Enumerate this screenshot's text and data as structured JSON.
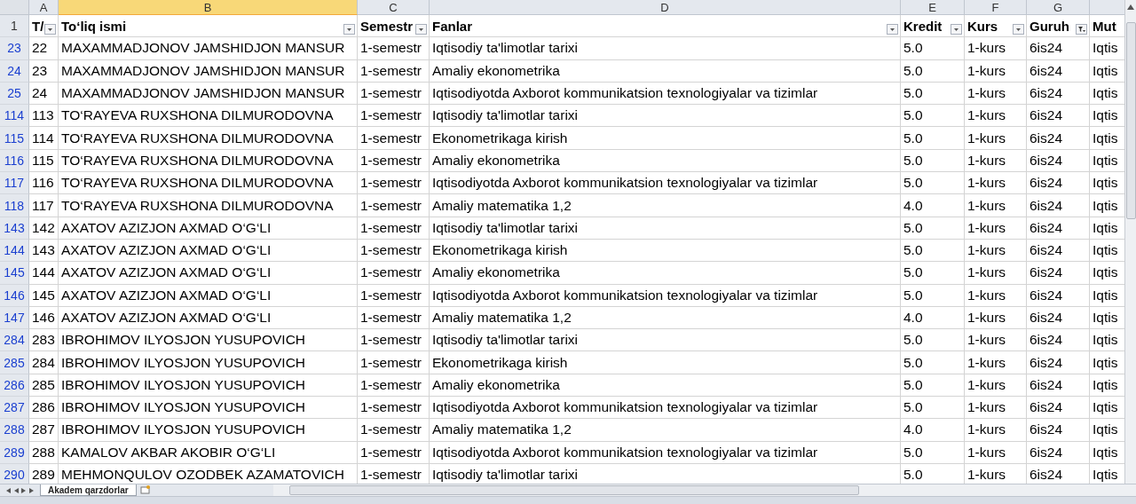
{
  "columns": [
    {
      "letter": "A",
      "selected": false
    },
    {
      "letter": "B",
      "selected": true
    },
    {
      "letter": "C",
      "selected": false
    },
    {
      "letter": "D",
      "selected": false
    },
    {
      "letter": "E",
      "selected": false
    },
    {
      "letter": "F",
      "selected": false
    },
    {
      "letter": "G",
      "selected": false
    }
  ],
  "header_row": {
    "number": "1",
    "cells": [
      {
        "text": "T/",
        "filtered": false
      },
      {
        "text": "To‘liq ismi",
        "filtered": false
      },
      {
        "text": "Semestr",
        "filtered": false
      },
      {
        "text": "Fanlar",
        "filtered": false
      },
      {
        "text": "Kredit",
        "filtered": false
      },
      {
        "text": "Kurs",
        "filtered": false
      },
      {
        "text": "Guruh",
        "filtered": true
      },
      {
        "text": "Mut"
      }
    ]
  },
  "rows": [
    {
      "number": "23",
      "cells": [
        "22",
        "MAXAMMADJONOV JAMSHIDJON MANSUR",
        "1-semestr",
        "Iqtisodiy ta'limotlar tarixi",
        "5.0",
        "1-kurs",
        "6is24",
        "Iqtis"
      ]
    },
    {
      "number": "24",
      "cells": [
        "23",
        "MAXAMMADJONOV JAMSHIDJON MANSUR",
        "1-semestr",
        "Amaliy ekonometrika",
        "5.0",
        "1-kurs",
        "6is24",
        "Iqtis"
      ]
    },
    {
      "number": "25",
      "cells": [
        "24",
        "MAXAMMADJONOV JAMSHIDJON MANSUR",
        "1-semestr",
        "Iqtisodiyotda Axborot kommunikatsion texnologiyalar va tizimlar",
        "5.0",
        "1-kurs",
        "6is24",
        "Iqtis"
      ]
    },
    {
      "number": "114",
      "cells": [
        "113",
        "TO‘RAYEVA RUXSHONA DILMURODOVNA",
        "1-semestr",
        "Iqtisodiy ta'limotlar tarixi",
        "5.0",
        "1-kurs",
        "6is24",
        "Iqtis"
      ]
    },
    {
      "number": "115",
      "cells": [
        "114",
        "TO‘RAYEVA RUXSHONA DILMURODOVNA",
        "1-semestr",
        "Ekonometrikaga kirish",
        "5.0",
        "1-kurs",
        "6is24",
        "Iqtis"
      ]
    },
    {
      "number": "116",
      "cells": [
        "115",
        "TO‘RAYEVA RUXSHONA DILMURODOVNA",
        "1-semestr",
        "Amaliy ekonometrika",
        "5.0",
        "1-kurs",
        "6is24",
        "Iqtis"
      ]
    },
    {
      "number": "117",
      "cells": [
        "116",
        "TO‘RAYEVA RUXSHONA DILMURODOVNA",
        "1-semestr",
        "Iqtisodiyotda Axborot kommunikatsion texnologiyalar va tizimlar",
        "5.0",
        "1-kurs",
        "6is24",
        "Iqtis"
      ]
    },
    {
      "number": "118",
      "cells": [
        "117",
        "TO‘RAYEVA RUXSHONA DILMURODOVNA",
        "1-semestr",
        "Amaliy matematika 1,2",
        "4.0",
        "1-kurs",
        "6is24",
        "Iqtis"
      ]
    },
    {
      "number": "143",
      "cells": [
        "142",
        "AXATOV AZIZJON AXMAD O‘G‘LI",
        "1-semestr",
        "Iqtisodiy ta'limotlar tarixi",
        "5.0",
        "1-kurs",
        "6is24",
        "Iqtis"
      ]
    },
    {
      "number": "144",
      "cells": [
        "143",
        "AXATOV AZIZJON AXMAD O‘G‘LI",
        "1-semestr",
        "Ekonometrikaga kirish",
        "5.0",
        "1-kurs",
        "6is24",
        "Iqtis"
      ]
    },
    {
      "number": "145",
      "cells": [
        "144",
        "AXATOV AZIZJON AXMAD O‘G‘LI",
        "1-semestr",
        "Amaliy ekonometrika",
        "5.0",
        "1-kurs",
        "6is24",
        "Iqtis"
      ]
    },
    {
      "number": "146",
      "cells": [
        "145",
        "AXATOV AZIZJON AXMAD O‘G‘LI",
        "1-semestr",
        "Iqtisodiyotda Axborot kommunikatsion texnologiyalar va tizimlar",
        "5.0",
        "1-kurs",
        "6is24",
        "Iqtis"
      ]
    },
    {
      "number": "147",
      "cells": [
        "146",
        "AXATOV AZIZJON AXMAD O‘G‘LI",
        "1-semestr",
        "Amaliy matematika 1,2",
        "4.0",
        "1-kurs",
        "6is24",
        "Iqtis"
      ]
    },
    {
      "number": "284",
      "cells": [
        "283",
        "IBROHIMOV ILYOSJON YUSUPOVICH",
        "1-semestr",
        "Iqtisodiy ta'limotlar tarixi",
        "5.0",
        "1-kurs",
        "6is24",
        "Iqtis"
      ]
    },
    {
      "number": "285",
      "cells": [
        "284",
        "IBROHIMOV ILYOSJON YUSUPOVICH",
        "1-semestr",
        "Ekonometrikaga kirish",
        "5.0",
        "1-kurs",
        "6is24",
        "Iqtis"
      ]
    },
    {
      "number": "286",
      "cells": [
        "285",
        "IBROHIMOV ILYOSJON YUSUPOVICH",
        "1-semestr",
        "Amaliy ekonometrika",
        "5.0",
        "1-kurs",
        "6is24",
        "Iqtis"
      ]
    },
    {
      "number": "287",
      "cells": [
        "286",
        "IBROHIMOV ILYOSJON YUSUPOVICH",
        "1-semestr",
        "Iqtisodiyotda Axborot kommunikatsion texnologiyalar va tizimlar",
        "5.0",
        "1-kurs",
        "6is24",
        "Iqtis"
      ]
    },
    {
      "number": "288",
      "cells": [
        "287",
        "IBROHIMOV ILYOSJON YUSUPOVICH",
        "1-semestr",
        "Amaliy matematika 1,2",
        "4.0",
        "1-kurs",
        "6is24",
        "Iqtis"
      ]
    },
    {
      "number": "289",
      "cells": [
        "288",
        "KAMALOV AKBAR AKOBIR O‘G‘LI",
        "1-semestr",
        "Iqtisodiyotda Axborot kommunikatsion texnologiyalar va tizimlar",
        "5.0",
        "1-kurs",
        "6is24",
        "Iqtis"
      ]
    },
    {
      "number": "290",
      "cells": [
        "289",
        "MEHMONQULOV OZODBEK AZAMATOVICH",
        "1-semestr",
        "Iqtisodiy ta'limotlar tarixi",
        "5.0",
        "1-kurs",
        "6is24",
        "Iqtis"
      ]
    }
  ],
  "sheet_tabs": [
    {
      "label": "Akadem qarzdorlar",
      "selected": true
    }
  ]
}
